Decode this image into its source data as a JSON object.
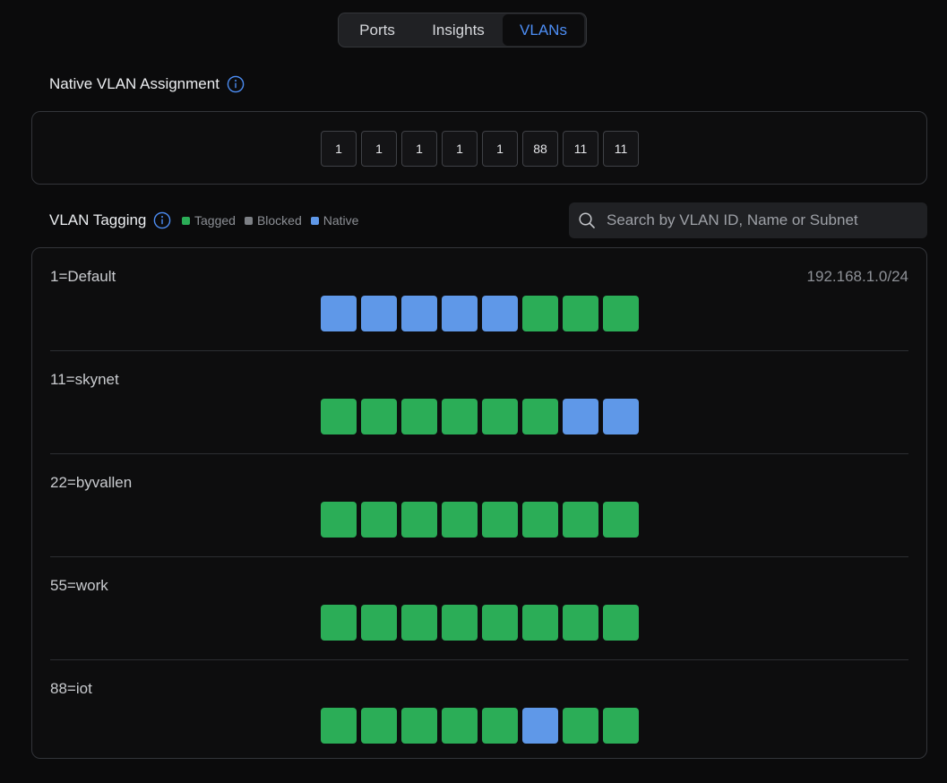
{
  "tabs": [
    {
      "label": "Ports",
      "active": false
    },
    {
      "label": "Insights",
      "active": false
    },
    {
      "label": "VLANs",
      "active": true
    }
  ],
  "native_section": {
    "title": "Native VLAN Assignment",
    "ports": [
      "1",
      "1",
      "1",
      "1",
      "1",
      "88",
      "11",
      "11"
    ]
  },
  "tagging_section": {
    "title": "VLAN Tagging",
    "legend": [
      {
        "label": "Tagged",
        "color": "#2bad57"
      },
      {
        "label": "Blocked",
        "color": "#7d8085"
      },
      {
        "label": "Native",
        "color": "#5f98e8"
      }
    ],
    "search_placeholder": "Search by VLAN ID, Name or Subnet"
  },
  "colors": {
    "tagged": "#2bad57",
    "blocked": "#7d8085",
    "native": "#5f98e8",
    "accent": "#4d8ef5"
  },
  "vlans": [
    {
      "name": "1=Default",
      "subnet": "192.168.1.0/24",
      "ports": [
        "native",
        "native",
        "native",
        "native",
        "native",
        "tagged",
        "tagged",
        "tagged"
      ]
    },
    {
      "name": "11=skynet",
      "subnet": "",
      "ports": [
        "tagged",
        "tagged",
        "tagged",
        "tagged",
        "tagged",
        "tagged",
        "native",
        "native"
      ]
    },
    {
      "name": "22=byvallen",
      "subnet": "",
      "ports": [
        "tagged",
        "tagged",
        "tagged",
        "tagged",
        "tagged",
        "tagged",
        "tagged",
        "tagged"
      ]
    },
    {
      "name": "55=work",
      "subnet": "",
      "ports": [
        "tagged",
        "tagged",
        "tagged",
        "tagged",
        "tagged",
        "tagged",
        "tagged",
        "tagged"
      ]
    },
    {
      "name": "88=iot",
      "subnet": "",
      "ports": [
        "tagged",
        "tagged",
        "tagged",
        "tagged",
        "tagged",
        "native",
        "tagged",
        "tagged"
      ]
    }
  ]
}
